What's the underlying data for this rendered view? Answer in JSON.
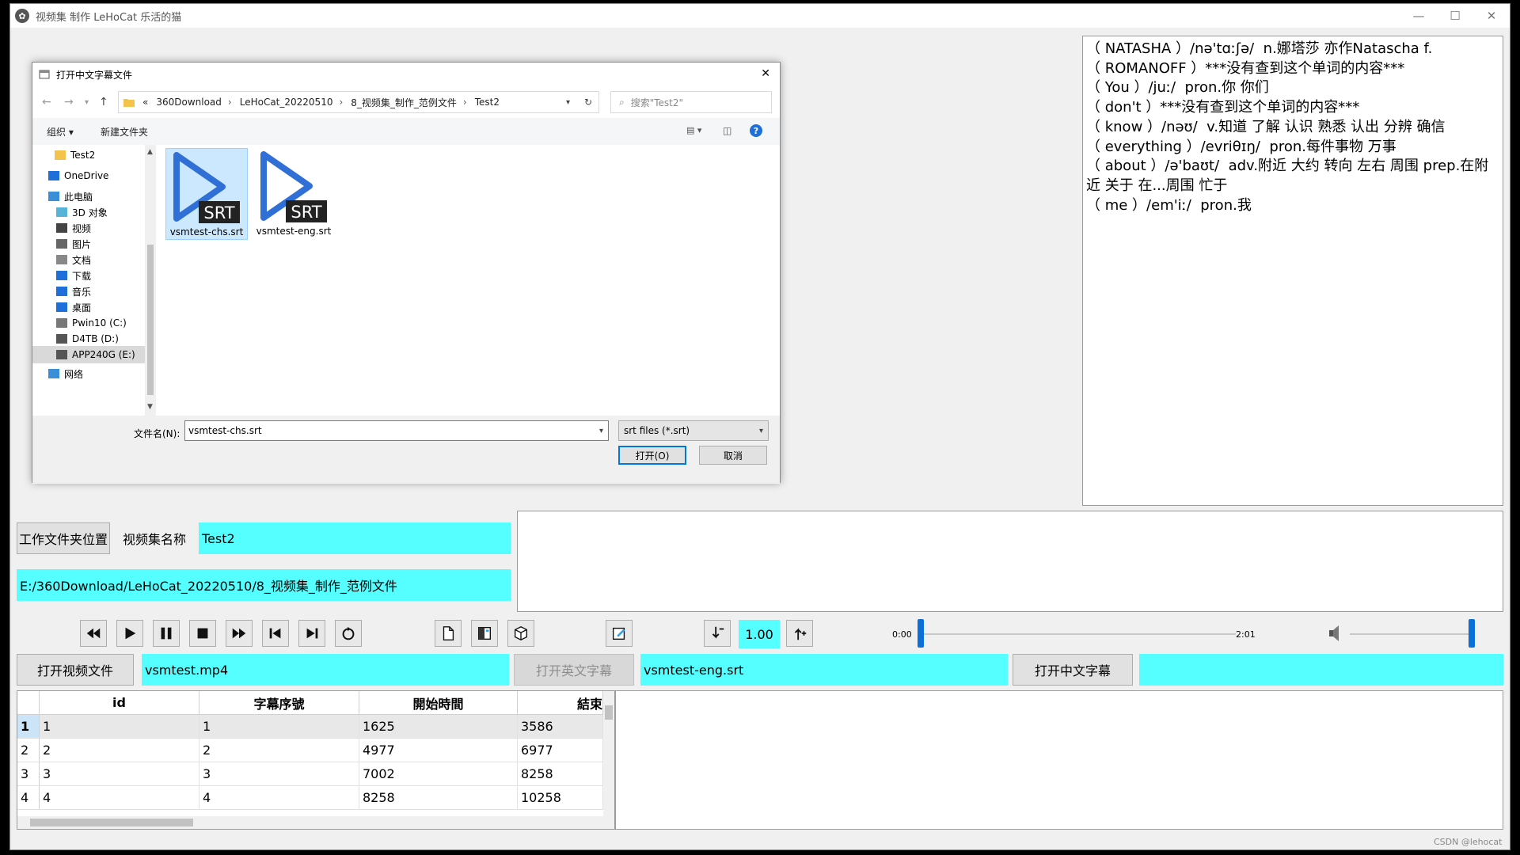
{
  "window": {
    "title": "视频集 制作  LeHoCat 乐活的猫",
    "minimize": "—",
    "maximize": "☐",
    "close": "✕"
  },
  "dictionary": {
    "lines": [
      "（ NATASHA ）/nə'tɑːʃə/  n.娜塔莎 亦作Natascha f.",
      "（ ROMANOFF ）***没有查到这个单词的内容***",
      "（ You ）/juː/  pron.你 你们",
      "（ don't ）***没有查到这个单词的内容***",
      "（ know ）/nəʊ/  v.知道 了解 认识 熟悉 认出 分辨 确信",
      "（ everything ）/evriθɪŋ/  pron.每件事物 万事",
      "（ about ）/ə'baʊt/  adv.附近 大约 转向 左右 周围 prep.在附近 关于 在...周围 忙于",
      "（ me ）/em'iː/  pron.我"
    ]
  },
  "controls": {
    "workdir_button": "工作文件夹位置",
    "set_name_label": "视频集名称",
    "set_name_value": "Test2",
    "path_value": "E:/360Download/LeHoCat_20220510/8_视频集_制作_范例文件",
    "speed_value": "1.00",
    "time_start": "0:00",
    "time_end": "2:01",
    "seek_fraction": 0.0,
    "volume_fraction": 1.0,
    "open_video_button": "打开视频文件",
    "video_file": "vsmtest.mp4",
    "open_eng_button": "打开英文字幕",
    "eng_file": "vsmtest-eng.srt",
    "open_chs_button": "打开中文字幕",
    "chs_file": ""
  },
  "table": {
    "columns": [
      "id",
      "字幕序號",
      "開始時間",
      "結束"
    ],
    "row_headers": [
      "1",
      "2",
      "3",
      "4"
    ],
    "rows": [
      [
        "1",
        "1",
        "1625",
        "3586"
      ],
      [
        "2",
        "2",
        "4977",
        "6977"
      ],
      [
        "3",
        "3",
        "7002",
        "8258"
      ],
      [
        "4",
        "4",
        "8258",
        "10258"
      ]
    ]
  },
  "dialog": {
    "title": "打开中文字幕文件",
    "close": "✕",
    "breadcrumb": [
      "«",
      "360Download",
      "LeHoCat_20220510",
      "8_视频集_制作_范例文件",
      "Test2"
    ],
    "search_placeholder": "搜索\"Test2\"",
    "organize": "组织 ▾",
    "new_folder": "新建文件夹",
    "nav_items": [
      "Test2",
      "OneDrive",
      "此电脑",
      "3D 对象",
      "视频",
      "图片",
      "文档",
      "下载",
      "音乐",
      "桌面",
      "Pwin10 (C:)",
      "D4TB (D:)",
      "APP240G (E:)",
      "网络"
    ],
    "files": [
      {
        "name": "vsmtest-chs.srt",
        "badge": "SRT",
        "selected": true
      },
      {
        "name": "vsmtest-eng.srt",
        "badge": "SRT",
        "selected": false
      }
    ],
    "filename_label": "文件名(N):",
    "filename_value": "vsmtest-chs.srt",
    "filetype_value": "srt files (*.srt)",
    "open_button": "打开(O)",
    "cancel_button": "取消"
  },
  "watermark": "CSDN @lehocat"
}
